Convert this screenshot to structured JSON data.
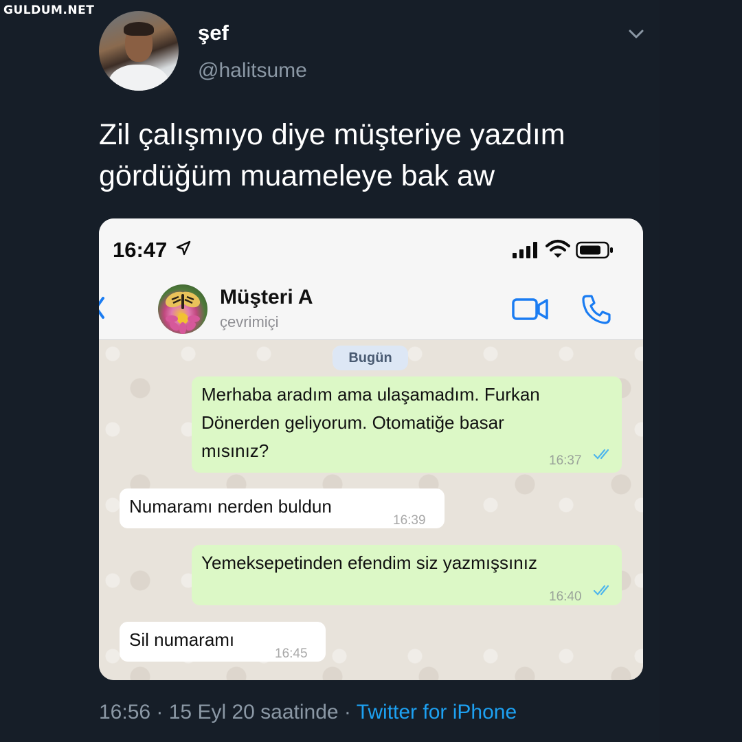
{
  "watermark": "GULDUM.NET",
  "tweet": {
    "display_name": "şef",
    "handle": "@halitsume",
    "text_lines": [
      "Zil çalışmıyo diye müşteriye yazdım",
      "gördüğüm muameleye bak aw"
    ],
    "timestamp": "16:56 · 15 Eyl 20 saatinde · ",
    "source": "Twitter for iPhone",
    "menu_icon": "chevron-down-icon"
  },
  "phone": {
    "status_time": "16:47",
    "status_icons": [
      "location-arrow-icon",
      "signal-icon",
      "wifi-icon",
      "battery-icon"
    ]
  },
  "chat": {
    "contact_name": "Müşteri A",
    "contact_status": "çevrimiçi",
    "date_label": "Bugün",
    "header_icons": [
      "back-chevron-icon",
      "video-call-icon",
      "phone-call-icon"
    ],
    "messages": [
      {
        "direction": "outgoing",
        "lines": [
          "Merhaba aradım ama ulaşamadım. Furkan",
          "Dönerden geliyorum. Otomatiğe basar",
          "mısınız?"
        ],
        "time": "16:37",
        "read": true
      },
      {
        "direction": "incoming",
        "lines": [
          "Numaramı nerden buldun"
        ],
        "time": "16:39"
      },
      {
        "direction": "outgoing",
        "lines": [
          "Yemeksepetinden efendim siz yazmışsınız"
        ],
        "time": "16:40",
        "read": true
      },
      {
        "direction": "incoming",
        "lines": [
          "Sil numaramı"
        ],
        "time": "16:45"
      }
    ]
  },
  "colors": {
    "background": "#151c26",
    "outgoing_bubble": "#dcf8c6",
    "incoming_bubble": "#ffffff",
    "link": "#1da1f2",
    "read_ticks": "#4fb6ec"
  }
}
